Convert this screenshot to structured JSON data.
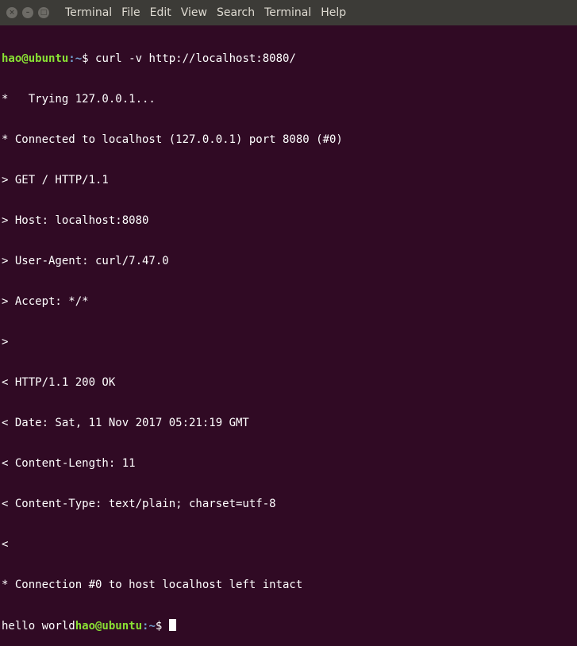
{
  "window": {
    "menu": [
      "Terminal",
      "File",
      "Edit",
      "View",
      "Search",
      "Terminal",
      "Help"
    ],
    "buttons": {
      "close": "×",
      "minimize": "–",
      "maximize": "□"
    }
  },
  "terminal": {
    "prompt_user": "hao@ubuntu",
    "prompt_path": ":~",
    "prompt_symbol": "$ ",
    "command": "curl -v http://localhost:8080/",
    "output": [
      "*   Trying 127.0.0.1...",
      "* Connected to localhost (127.0.0.1) port 8080 (#0)",
      "> GET / HTTP/1.1",
      "> Host: localhost:8080",
      "> User-Agent: curl/7.47.0",
      "> Accept: */*",
      ">",
      "< HTTP/1.1 200 OK",
      "< Date: Sat, 11 Nov 2017 05:21:19 GMT",
      "< Content-Length: 11",
      "< Content-Type: text/plain; charset=utf-8",
      "<",
      "* Connection #0 to host localhost left intact"
    ],
    "last_output": "hello world",
    "colors": {
      "user": "#8ae234",
      "path": "#729fcf",
      "background": "#300a24"
    }
  }
}
